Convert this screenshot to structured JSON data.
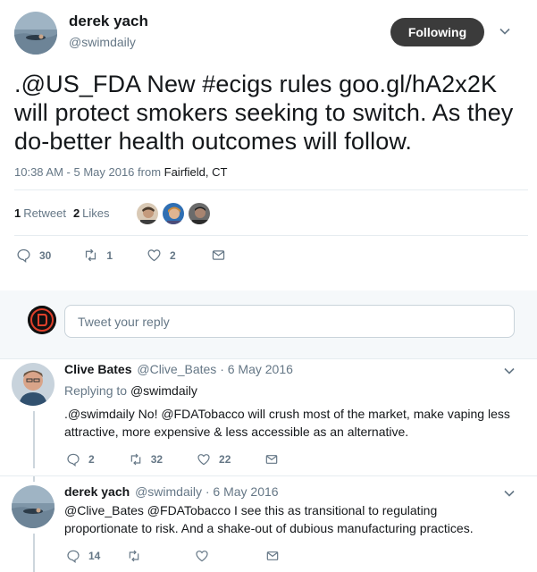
{
  "tweet": {
    "author": {
      "name": "derek yach",
      "handle": "@swimdaily"
    },
    "follow_label": "Following",
    "text": ".@US_FDA New #ecigs rules goo.gl/hA2x2K will protect smokers seeking to switch. As they do-better health outcomes will follow.",
    "meta_time": "10:38 AM - 5 May 2016 from ",
    "meta_place": "Fairfield, CT",
    "stats": {
      "retweets_count": "1",
      "retweets_label": "Retweet",
      "likes_count": "2",
      "likes_label": "Likes"
    },
    "actions": {
      "replies": "30",
      "retweets": "1",
      "likes": "2"
    }
  },
  "reply_box": {
    "placeholder": "Tweet your reply"
  },
  "replies": [
    {
      "name": "Clive Bates",
      "handle": "@Clive_Bates",
      "date": "· 6 May 2016",
      "replying_prefix": "Replying to ",
      "replying_handle": "@swimdaily",
      "text": ".@swimdaily No! @FDATobacco will crush most of the market, make vaping less attractive, more expensive & less accessible as an alternative.",
      "actions": {
        "replies": "2",
        "retweets": "32",
        "likes": "22"
      }
    },
    {
      "name": "derek yach",
      "handle": "@swimdaily",
      "date": "· 6 May 2016",
      "text": "@Clive_Bates @FDATobacco I see this as transitional to regulating proportionate to risk. And a shake-out of dubious manufacturing practices.",
      "actions": {
        "replies": "14"
      }
    }
  ],
  "colors": {
    "muted": "#657786",
    "text": "#14171a",
    "follow_bg": "#3b3b3b",
    "divider": "#e6ecf0"
  },
  "icons": [
    "reply-icon",
    "retweet-icon",
    "like-icon",
    "message-icon",
    "chevron-down-icon"
  ]
}
